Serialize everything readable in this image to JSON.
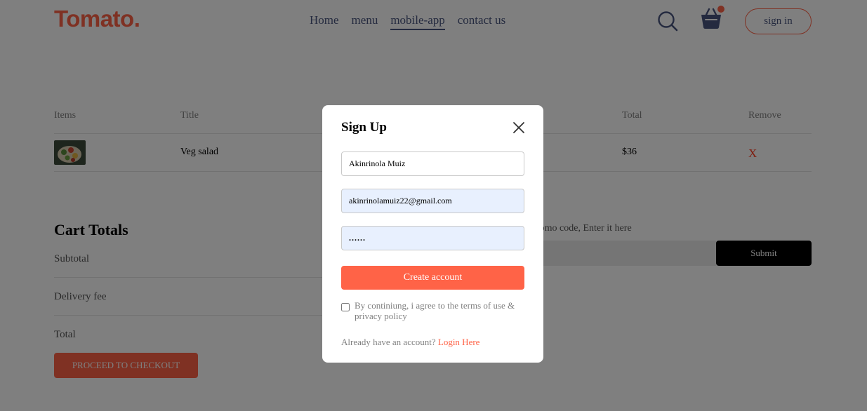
{
  "navbar": {
    "logo": "Tomato.",
    "menu": [
      "Home",
      "menu",
      "mobile-app",
      "contact us"
    ],
    "active_menu": "mobile-app",
    "sign_in": "sign in",
    "cart_has_items": true
  },
  "cart": {
    "headers": [
      "Items",
      "Title",
      "Total",
      "Remove"
    ],
    "rows": [
      {
        "title": "Veg salad",
        "total": "$36",
        "remove": "X"
      }
    ]
  },
  "totals": {
    "title": "Cart Totals",
    "subtotal_label": "Subtotal",
    "delivery_label": "Delivery fee",
    "total_label": "Total",
    "checkout": "PROCEED TO CHECKOUT"
  },
  "promo": {
    "text": "promo code, Enter it here",
    "submit": "Submit"
  },
  "popup": {
    "title": "Sign Up",
    "name_value": "Akinrinola Muiz",
    "email_value": "akinrinolamuiz22@gmail.com",
    "password_value": "......",
    "create_button": "Create account",
    "terms": "By continiung, i agree to the terms of use & privacy policy",
    "terms_checked": false,
    "already": "Already have an account?",
    "login_link": "Login Here"
  },
  "colors": {
    "accent": "#ff6347",
    "text": "#49557e",
    "overlay": "rgba(0,0,0,0.5)",
    "autofill": "#e8f0fe"
  }
}
